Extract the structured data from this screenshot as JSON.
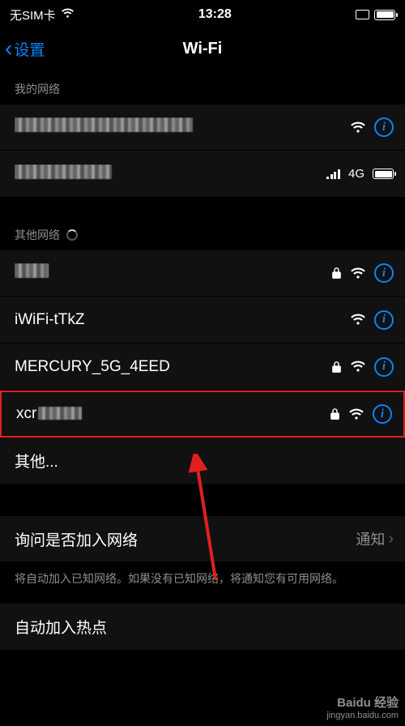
{
  "status": {
    "carrier": "无SIM卡",
    "time": "13:28",
    "cell_label": "4G"
  },
  "nav": {
    "back": "设置",
    "title": "Wi-Fi"
  },
  "sections": {
    "my": "我的网络",
    "other": "其他网络"
  },
  "my_networks": [
    {
      "name_hidden": true
    },
    {
      "name_hidden": true,
      "cellular": true
    }
  ],
  "other_networks": [
    {
      "name_hidden": true,
      "locked": true
    },
    {
      "name": "iWiFi-tTkZ",
      "locked": false
    },
    {
      "name": "MERCURY_5G_4EED",
      "locked": true
    },
    {
      "name": "xcr",
      "name_suffix_hidden": true,
      "locked": true,
      "highlighted": true
    }
  ],
  "other_label": "其他...",
  "ask": {
    "label": "询问是否加入网络",
    "value": "通知",
    "footer": "将自动加入已知网络。如果没有已知网络，将通知您有可用网络。"
  },
  "hotspot": {
    "label": "自动加入热点"
  },
  "watermark": {
    "brand": "Baidu 经验",
    "url": "jingyan.baidu.com"
  }
}
